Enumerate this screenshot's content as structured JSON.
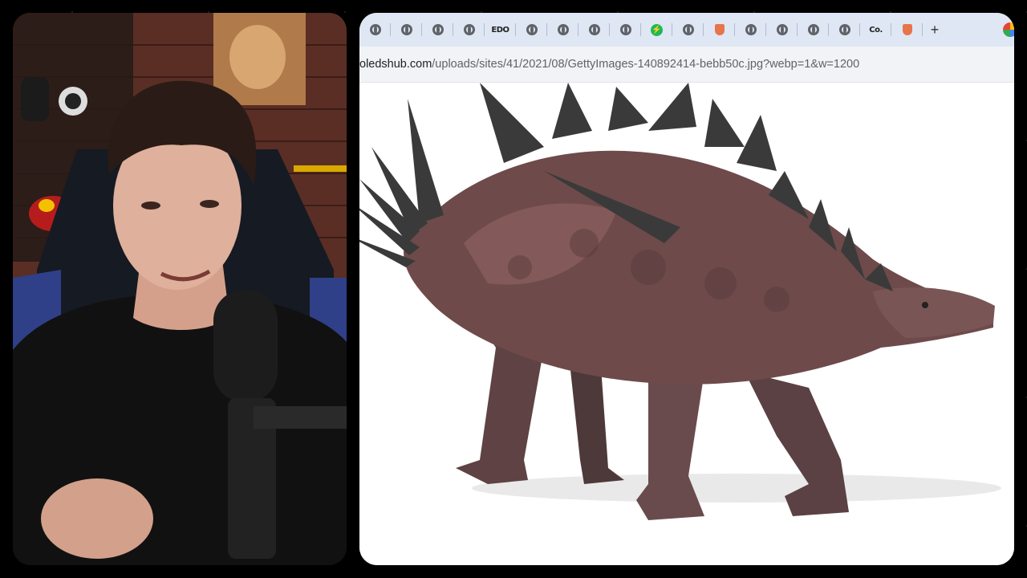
{
  "browser": {
    "tabs": [
      {
        "icon": "globe-icon"
      },
      {
        "icon": "globe-icon"
      },
      {
        "icon": "globe-icon"
      },
      {
        "icon": "globe-icon"
      },
      {
        "icon": "edo-icon",
        "text": "EDO"
      },
      {
        "icon": "globe-icon"
      },
      {
        "icon": "globe-icon"
      },
      {
        "icon": "globe-icon"
      },
      {
        "icon": "globe-icon"
      },
      {
        "icon": "green-bolt-icon"
      },
      {
        "icon": "globe-icon"
      },
      {
        "icon": "shield-icon"
      },
      {
        "icon": "globe-icon"
      },
      {
        "icon": "globe-icon"
      },
      {
        "icon": "globe-icon"
      },
      {
        "icon": "globe-icon"
      },
      {
        "icon": "co-icon",
        "text": "Co."
      },
      {
        "icon": "shield-icon"
      }
    ],
    "new_tab_label": "+",
    "url": {
      "host": "oledshub.com",
      "path": "/uploads/sites/41/2021/08/GettyImages-140892414-bebb50c.jpg?webp=1&w=1200"
    }
  },
  "colors": {
    "tabbar": "#dfe7f5",
    "addressbar": "#f1f3f6",
    "dino_body": "#6e4a4a",
    "dino_spikes": "#3a3a3a"
  }
}
